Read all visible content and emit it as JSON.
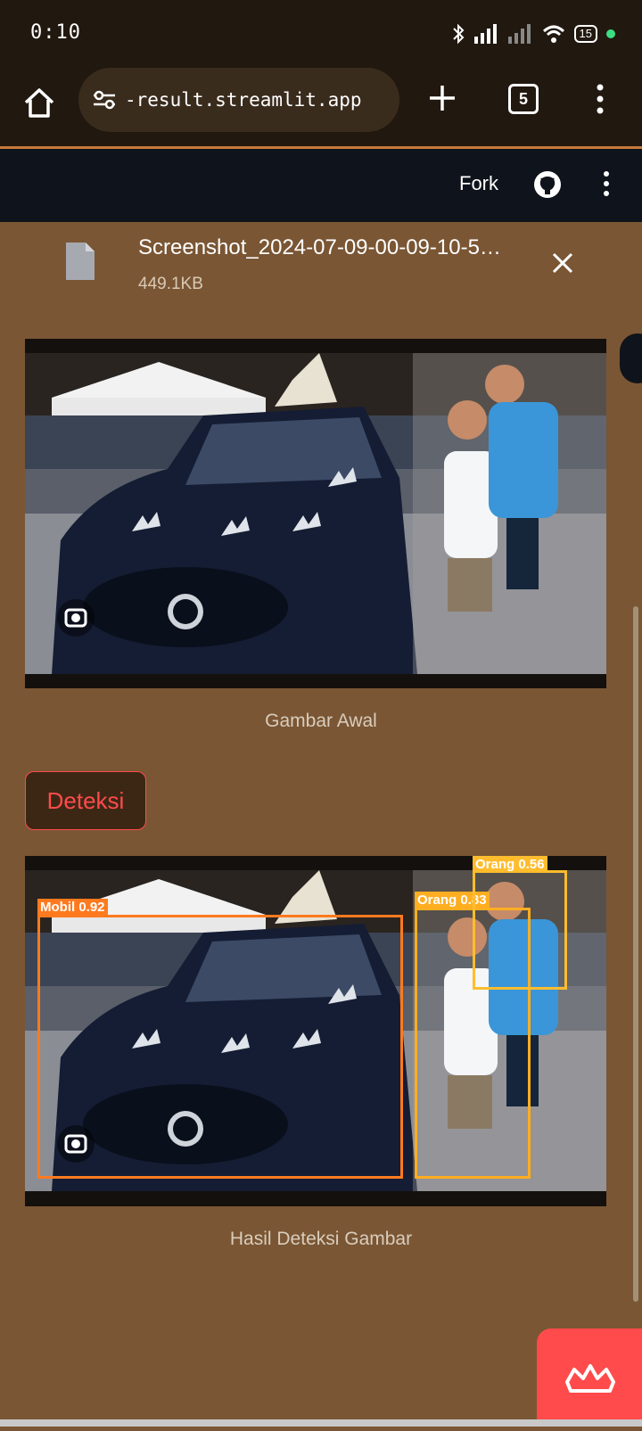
{
  "status_bar": {
    "time": "0:10",
    "battery": "15"
  },
  "browser": {
    "url": "-result.streamlit.app",
    "tab_count": "5"
  },
  "app_header": {
    "fork_label": "Fork"
  },
  "upload": {
    "file_name": "Screenshot_2024-07-09-00-09-10-5…",
    "file_size": "449.1KB"
  },
  "original_image": {
    "caption": "Gambar Awal"
  },
  "detect_button": {
    "label": "Deteksi"
  },
  "result_image": {
    "caption": "Hasil Deteksi Gambar",
    "detections": [
      {
        "label": "Mobil",
        "score": "0.92",
        "text": "Mobil 0.92",
        "color": "#ff7a1f"
      },
      {
        "label": "Orang",
        "score": "0.83",
        "text": "Orang 0.83",
        "color": "#ffae21"
      },
      {
        "label": "Orang",
        "score": "0.56",
        "text": "Orang 0.56",
        "color": "#ffbd2e"
      }
    ]
  },
  "colors": {
    "background": "#7a5634",
    "header": "#0f131b",
    "accent": "#ff4b4b"
  }
}
